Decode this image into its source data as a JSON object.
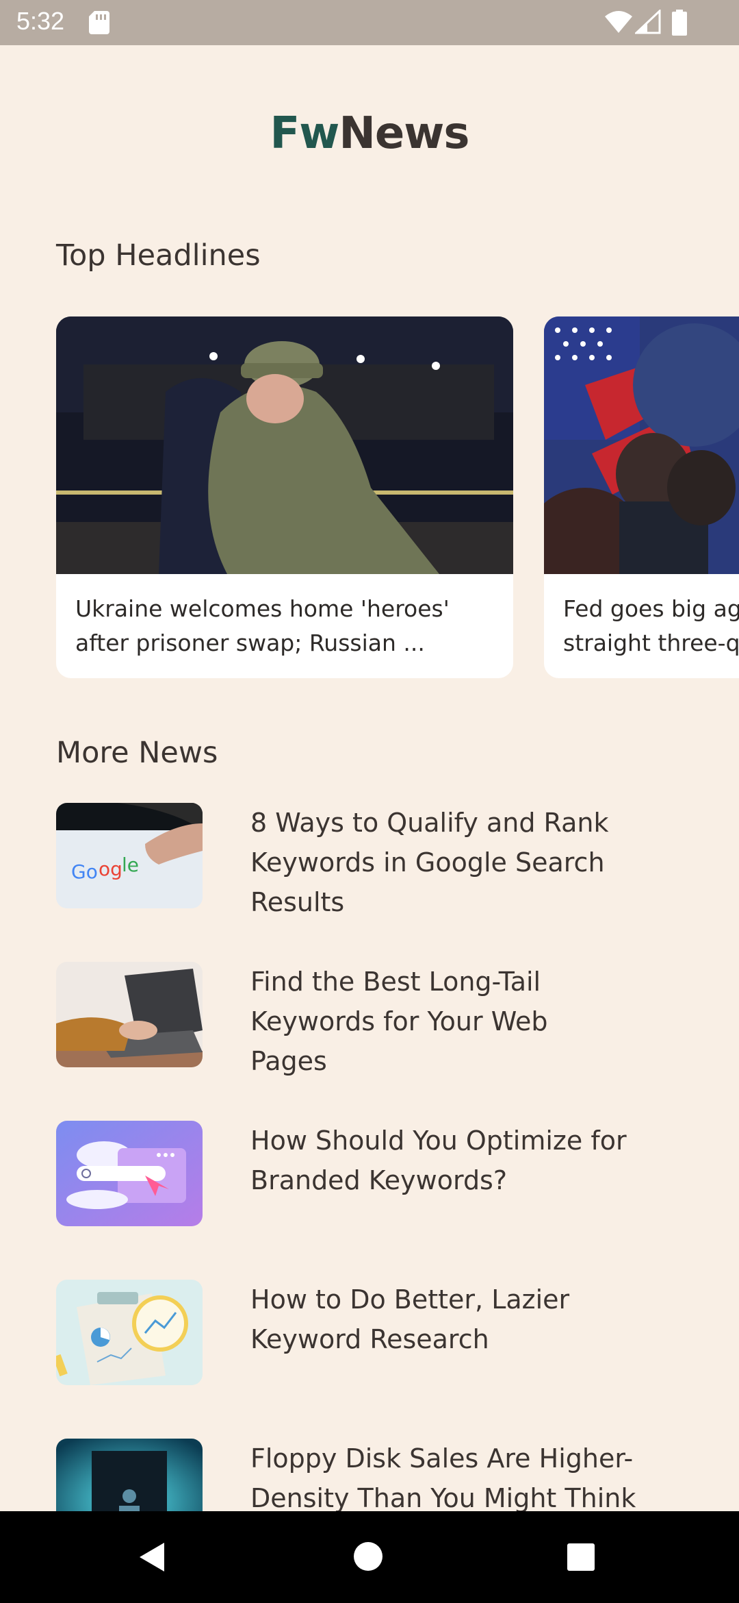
{
  "status_bar": {
    "time": "5:32",
    "icons": [
      "sd-card-icon",
      "wifi-icon",
      "signal-icon",
      "battery-icon"
    ]
  },
  "app": {
    "title_part1": "Fw",
    "title_part2": "News",
    "colors": {
      "brand_primary": "#22574e",
      "text": "#3b3431",
      "background": "#f9efe5"
    }
  },
  "top_headlines": {
    "section_title": "Top Headlines",
    "cards": [
      {
        "text": "Ukraine welcomes home 'heroes'\nafter prisoner swap; Russian ..."
      },
      {
        "text": "Fed goes big ag\nstraight three-q"
      }
    ]
  },
  "more_news": {
    "section_title": "More News",
    "items": [
      {
        "title": "8 Ways to Qualify and Rank\nKeywords in Google Search\nResults",
        "thumb": "google-search-thumbnail"
      },
      {
        "title": "Find the Best Long-Tail\nKeywords for Your Web\nPages",
        "thumb": "laptop-typing-thumbnail"
      },
      {
        "title": "How Should You Optimize for\nBranded Keywords?",
        "thumb": "search-illustration-thumbnail"
      },
      {
        "title": "How to Do Better, Lazier\nKeyword Research",
        "thumb": "analytics-illustration-thumbnail"
      },
      {
        "title": "Floppy Disk Sales Are Higher-\nDensity Than You Might Think",
        "thumb": "floppy-disk-thumbnail"
      }
    ]
  },
  "nav_bar": {
    "icons": [
      "back-icon",
      "home-icon",
      "recents-icon"
    ]
  }
}
